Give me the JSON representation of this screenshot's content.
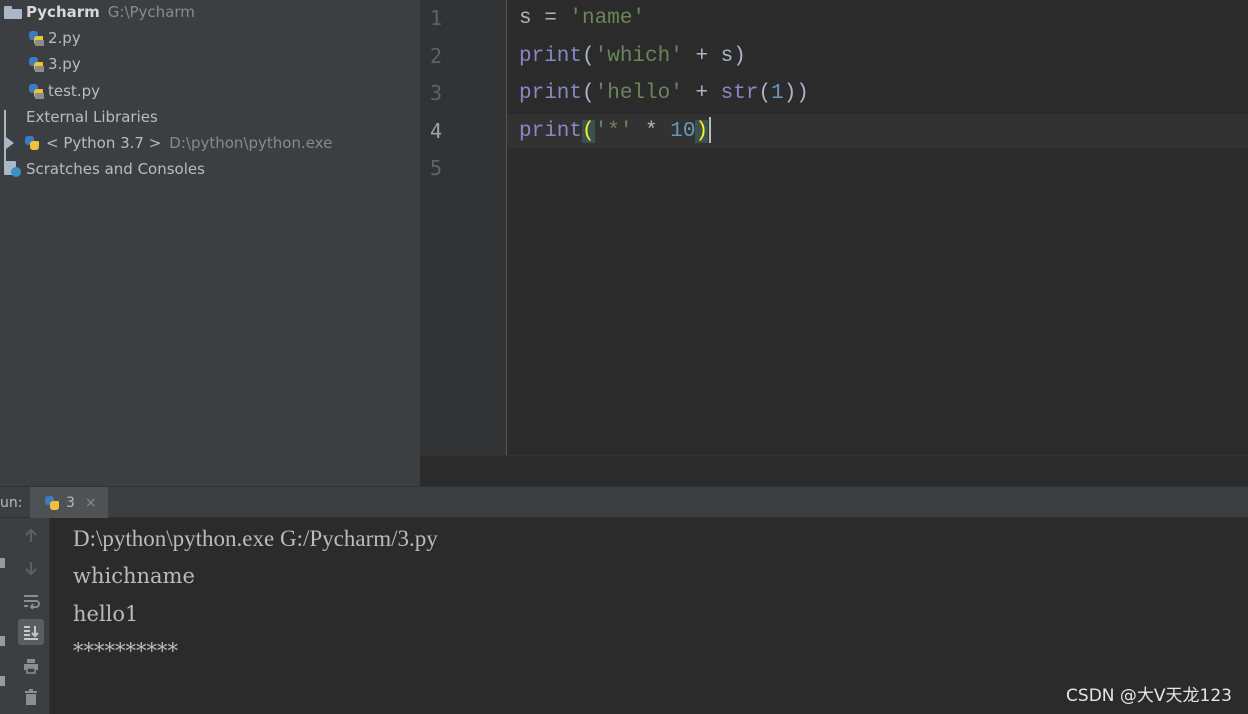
{
  "project_tree": {
    "root": {
      "name": "Pycharm",
      "path": "G:\\Pycharm"
    },
    "files": [
      {
        "name": "2.py"
      },
      {
        "name": "3.py"
      },
      {
        "name": "test.py"
      }
    ],
    "external_libraries": "External Libraries",
    "sdk": {
      "name": "< Python 3.7 >",
      "path": "D:\\python\\python.exe"
    },
    "scratches": "Scratches and Consoles"
  },
  "editor": {
    "line_numbers": [
      "1",
      "2",
      "3",
      "4",
      "5"
    ],
    "current_line": 4,
    "lines": [
      [
        {
          "t": "s = ",
          "c": ""
        },
        {
          "t": "'name'",
          "c": "str"
        }
      ],
      [
        {
          "t": "print",
          "c": "kw"
        },
        {
          "t": "(",
          "c": ""
        },
        {
          "t": "'which'",
          "c": "str"
        },
        {
          "t": " + s)",
          "c": ""
        }
      ],
      [
        {
          "t": "print",
          "c": "kw"
        },
        {
          "t": "(",
          "c": ""
        },
        {
          "t": "'hello'",
          "c": "str"
        },
        {
          "t": " + ",
          "c": ""
        },
        {
          "t": "str",
          "c": "kw"
        },
        {
          "t": "(",
          "c": ""
        },
        {
          "t": "1",
          "c": "num"
        },
        {
          "t": "))",
          "c": ""
        }
      ],
      [
        {
          "t": "print",
          "c": "kw"
        },
        {
          "t": "(",
          "c": "brace"
        },
        {
          "t": "'*'",
          "c": "str"
        },
        {
          "t": " * ",
          "c": ""
        },
        {
          "t": "10",
          "c": "num"
        },
        {
          "t": ")",
          "c": "brace"
        }
      ],
      []
    ]
  },
  "run_panel": {
    "label": "un:",
    "tab_label": "3",
    "tab_close": "×",
    "toolbar_icons": [
      "up-arrow-icon",
      "down-arrow-icon",
      "soft-wrap-icon",
      "scroll-to-end-icon",
      "print-icon",
      "trash-icon"
    ]
  },
  "console": {
    "lines": [
      "D:\\python\\python.exe G:/Pycharm/3.py",
      "whichname",
      "hello1",
      "**********"
    ]
  },
  "watermark": "CSDN @大V天龙123",
  "colors": {
    "editor_bg": "#2b2b2b",
    "panel_bg": "#3c3f41",
    "keyword": "#8888c6",
    "string": "#6a8759",
    "number": "#6897bb",
    "brace_match": "#ffef28"
  }
}
